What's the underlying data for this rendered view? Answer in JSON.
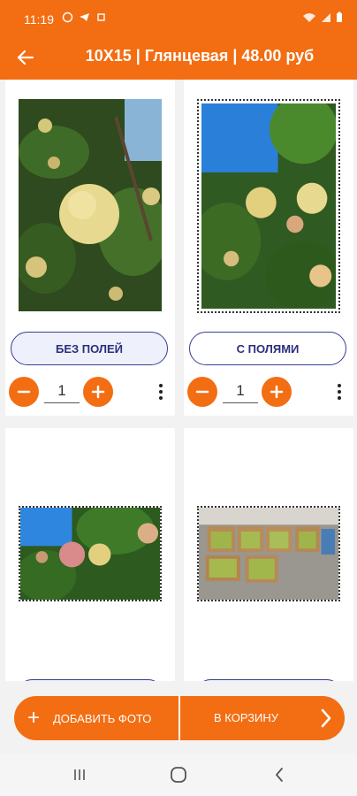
{
  "status_bar": {
    "time": "11:19"
  },
  "header": {
    "title": "10X15 | Глянцевая | 48.00 руб"
  },
  "cards": [
    {
      "mode_label": "БЕЗ ПОЛЕЙ",
      "quantity": "1"
    },
    {
      "mode_label": "С ПОЛЯМИ",
      "quantity": "1"
    }
  ],
  "actions": {
    "add_photo": "ДОБАВИТЬ ФОТО",
    "to_cart": "В КОРЗИНУ"
  },
  "icons": {
    "back": "arrow-left-icon",
    "minus": "minus-icon",
    "plus": "plus-icon",
    "more": "more-vertical-icon",
    "chevron": "chevron-right-icon",
    "nav_recents": "recents-icon",
    "nav_home": "home-icon",
    "nav_back": "nav-back-icon"
  },
  "colors": {
    "accent": "#f36d12",
    "button_border": "#3a3f92"
  }
}
